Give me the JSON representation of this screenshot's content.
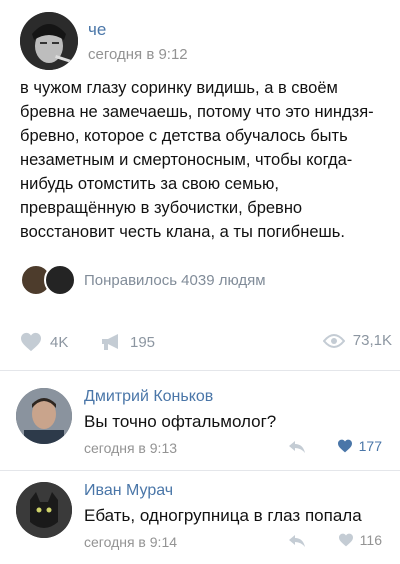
{
  "post": {
    "author": "че",
    "time": "сегодня в 9:12",
    "text": "в чужом глазу соринку видишь, а в своём\nбревна не замечаешь, потому что это ниндзя-\nбревно, которое с детства обучалось быть\nнезаметным и смертоносным, чтобы когда-\nнибудь отомстить за свою семью,\nпревращённую в зубочистки, бревно\nвосстановит честь клана, а ты погибнешь.",
    "liked_by": "Понравилось 4039 людям",
    "likes": "4K",
    "shares": "195",
    "views": "73,1K"
  },
  "comments": [
    {
      "author": "Дмитрий Коньков",
      "text": "Вы точно офтальмолог?",
      "time": "сегодня в 9:13",
      "likes": "177",
      "liked": true
    },
    {
      "author": "Иван Мурач",
      "text": "Ебать, одногрупница в глаз попала",
      "time": "сегодня в 9:14",
      "likes": "116",
      "liked": false
    }
  ],
  "colors": {
    "link": "#4a76a8",
    "meta": "#939393",
    "icon": "#aab4bf",
    "liked_heart": "#4a76a8"
  },
  "icons": {
    "like": "heart-icon",
    "share": "megaphone-icon",
    "views": "eye-icon",
    "reply": "reply-arrow-icon"
  }
}
